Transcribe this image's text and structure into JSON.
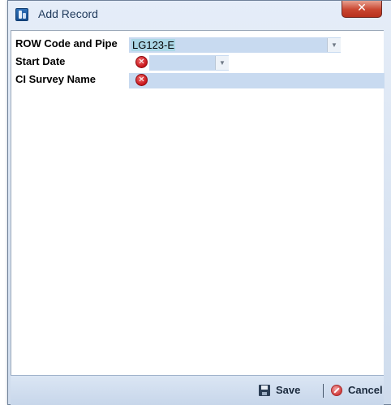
{
  "window": {
    "title": "Add Record",
    "close_glyph": "✕"
  },
  "form": {
    "fields": [
      {
        "label": "ROW Code and Pipe",
        "value": "LG123-E",
        "has_dropdown": true,
        "error": false
      },
      {
        "label": "Start Date",
        "value": "",
        "has_dropdown": true,
        "error": true
      },
      {
        "label": "CI Survey Name",
        "value": "",
        "has_dropdown": false,
        "error": true
      }
    ],
    "error_glyph": "✕",
    "dropdown_glyph": "▼"
  },
  "footer": {
    "save_label": "Save",
    "cancel_label": "Cancel",
    "separator": "|"
  },
  "icons": {
    "app": "app-icon",
    "close": "close-icon",
    "error": "error-icon",
    "dropdown": "chevron-down-icon",
    "save": "floppy-disk-icon",
    "cancel": "cancel-icon"
  },
  "colors": {
    "field_bg": "#c8daf0",
    "selection": "#abd7e6",
    "error_red": "#c8141a",
    "close_red": "#c9452f"
  }
}
